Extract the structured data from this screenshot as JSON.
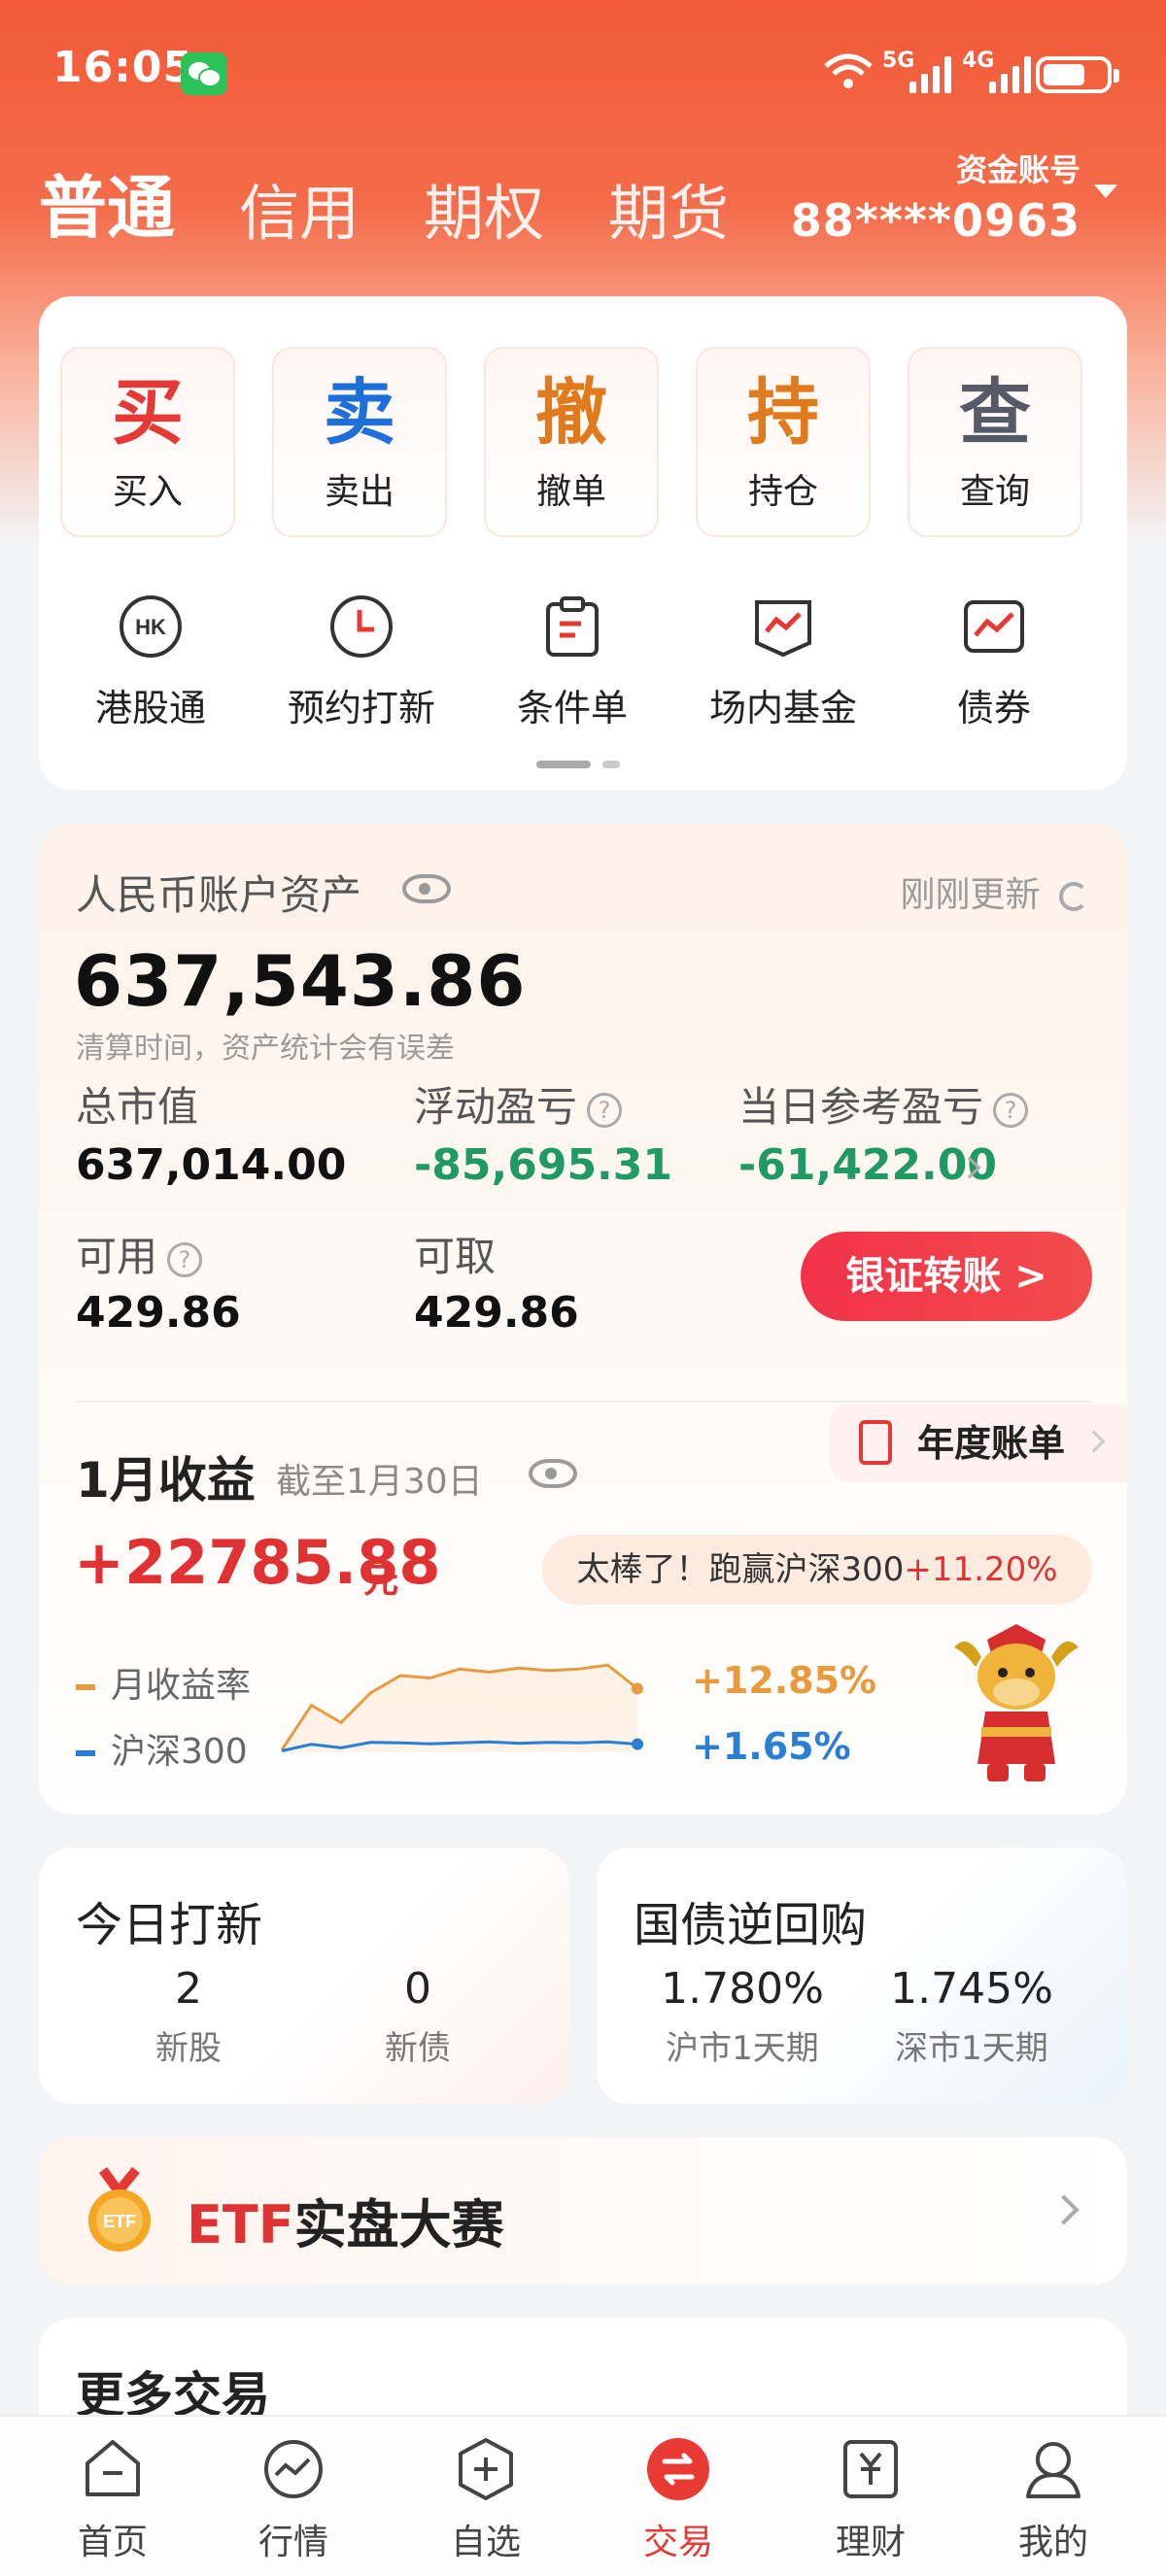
{
  "status": {
    "time": "16:05",
    "net1": "5G",
    "net2": "4G"
  },
  "account_tabs": [
    {
      "label": "普通",
      "active": true
    },
    {
      "label": "信用",
      "active": false
    },
    {
      "label": "期权",
      "active": false
    },
    {
      "label": "期货",
      "active": false
    }
  ],
  "account": {
    "label": "资金账号",
    "number": "88****0963"
  },
  "quick_actions": [
    {
      "glyph": "买",
      "label": "买入",
      "color": "#e53935"
    },
    {
      "glyph": "卖",
      "label": "卖出",
      "color": "#1e6fd9"
    },
    {
      "glyph": "撤",
      "label": "撤单",
      "color": "#e07a1c"
    },
    {
      "glyph": "持",
      "label": "持仓",
      "color": "#e07a1c"
    },
    {
      "glyph": "查",
      "label": "查询",
      "color": "#555a66"
    }
  ],
  "tools": [
    {
      "label": "港股通",
      "icon": "hk-icon"
    },
    {
      "label": "预约打新",
      "icon": "clock-icon"
    },
    {
      "label": "条件单",
      "icon": "clipboard-icon"
    },
    {
      "label": "场内基金",
      "icon": "fund-chart-icon"
    },
    {
      "label": "债券",
      "icon": "bond-chart-icon"
    }
  ],
  "assets": {
    "title": "人民币账户资产",
    "updated": "刚刚更新",
    "total": "637,543.86",
    "note": "清算时间，资产统计会有误差",
    "market_value_label": "总市值",
    "market_value": "637,014.00",
    "floating_pl_label": "浮动盈亏",
    "floating_pl": "-85,695.31",
    "daily_pl_label": "当日参考盈亏",
    "daily_pl": "-61,422.00",
    "available_label": "可用",
    "available": "429.86",
    "withdrawable_label": "可取",
    "withdrawable": "429.86",
    "transfer_button": "银证转账 >"
  },
  "annual_bill": "年度账单",
  "monthly": {
    "title": "1月收益",
    "as_of": "截至1月30日",
    "value": "+22785.88",
    "unit": "元",
    "bubble_prefix": "太棒了！跑赢沪深300",
    "bubble_highlight": "+11.20%",
    "series_a_name": "月收益率",
    "series_a_pct": "+12.85%",
    "series_b_name": "沪深300",
    "series_b_pct": "+1.65%",
    "color_a": "#e89a3c",
    "color_b": "#2a7fd4"
  },
  "chart_data": {
    "type": "line",
    "series": [
      {
        "name": "月收益率",
        "values": [
          0.5,
          9.5,
          6.0,
          12.0,
          15.5,
          15.0,
          16.8,
          16.2,
          17.0,
          16.5,
          16.8,
          17.6,
          12.85
        ]
      },
      {
        "name": "沪深300",
        "values": [
          0.3,
          1.6,
          0.9,
          2.0,
          1.9,
          1.7,
          1.9,
          2.1,
          1.8,
          2.0,
          1.9,
          2.1,
          1.65
        ]
      }
    ],
    "ylim": [
      0,
      20
    ],
    "grid": false,
    "legend": "left"
  },
  "ipo": {
    "title": "今日打新",
    "stocks_count": "2",
    "stocks_label": "新股",
    "bonds_count": "0",
    "bonds_label": "新债"
  },
  "repo": {
    "title": "国债逆回购",
    "sh_rate": "1.780%",
    "sh_label": "沪市1天期",
    "sz_rate": "1.745%",
    "sz_label": "深市1天期"
  },
  "etf": {
    "highlight": "ETF",
    "rest": "实盘大赛"
  },
  "more_trading": "更多交易",
  "bottom_tabs": [
    {
      "label": "首页",
      "icon": "home-icon",
      "active": false
    },
    {
      "label": "行情",
      "icon": "market-icon",
      "active": false
    },
    {
      "label": "自选",
      "icon": "watchlist-icon",
      "active": false
    },
    {
      "label": "交易",
      "icon": "trade-icon",
      "active": true
    },
    {
      "label": "理财",
      "icon": "wealth-icon",
      "active": false
    },
    {
      "label": "我的",
      "icon": "profile-icon",
      "active": false
    }
  ]
}
